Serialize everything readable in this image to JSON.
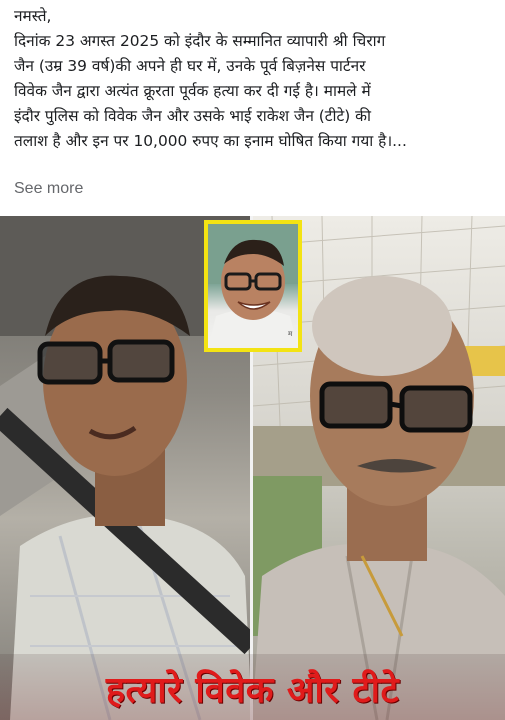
{
  "post": {
    "lines": [
      "नमस्ते,",
      "दिनांक 23 अगस्त 2025 को इंदौर के सम्मानित व्यापारी श्री चिराग",
      "जैन (उम्र 39 वर्ष)की अपने ही घर में,  उनके पूर्व बिज़नेस पार्टनर",
      "विवेक जैन द्वारा अत्यंत क्रूरता पूर्वक हत्या कर दी गई है।  मामले में",
      "इंदौर पुलिस को विवेक जैन और उसके भाई राकेश जैन (टीटे) की",
      "तलाश है और इन पर 10,000 रुपए का इनाम घोषित किया गया है।..."
    ],
    "see_more": "See more"
  },
  "media": {
    "caption": "हत्यारे विवेक और टीटे",
    "inset_mark": "म",
    "caption_color": "#e01b1b",
    "inset_border_color": "#f3e313"
  }
}
